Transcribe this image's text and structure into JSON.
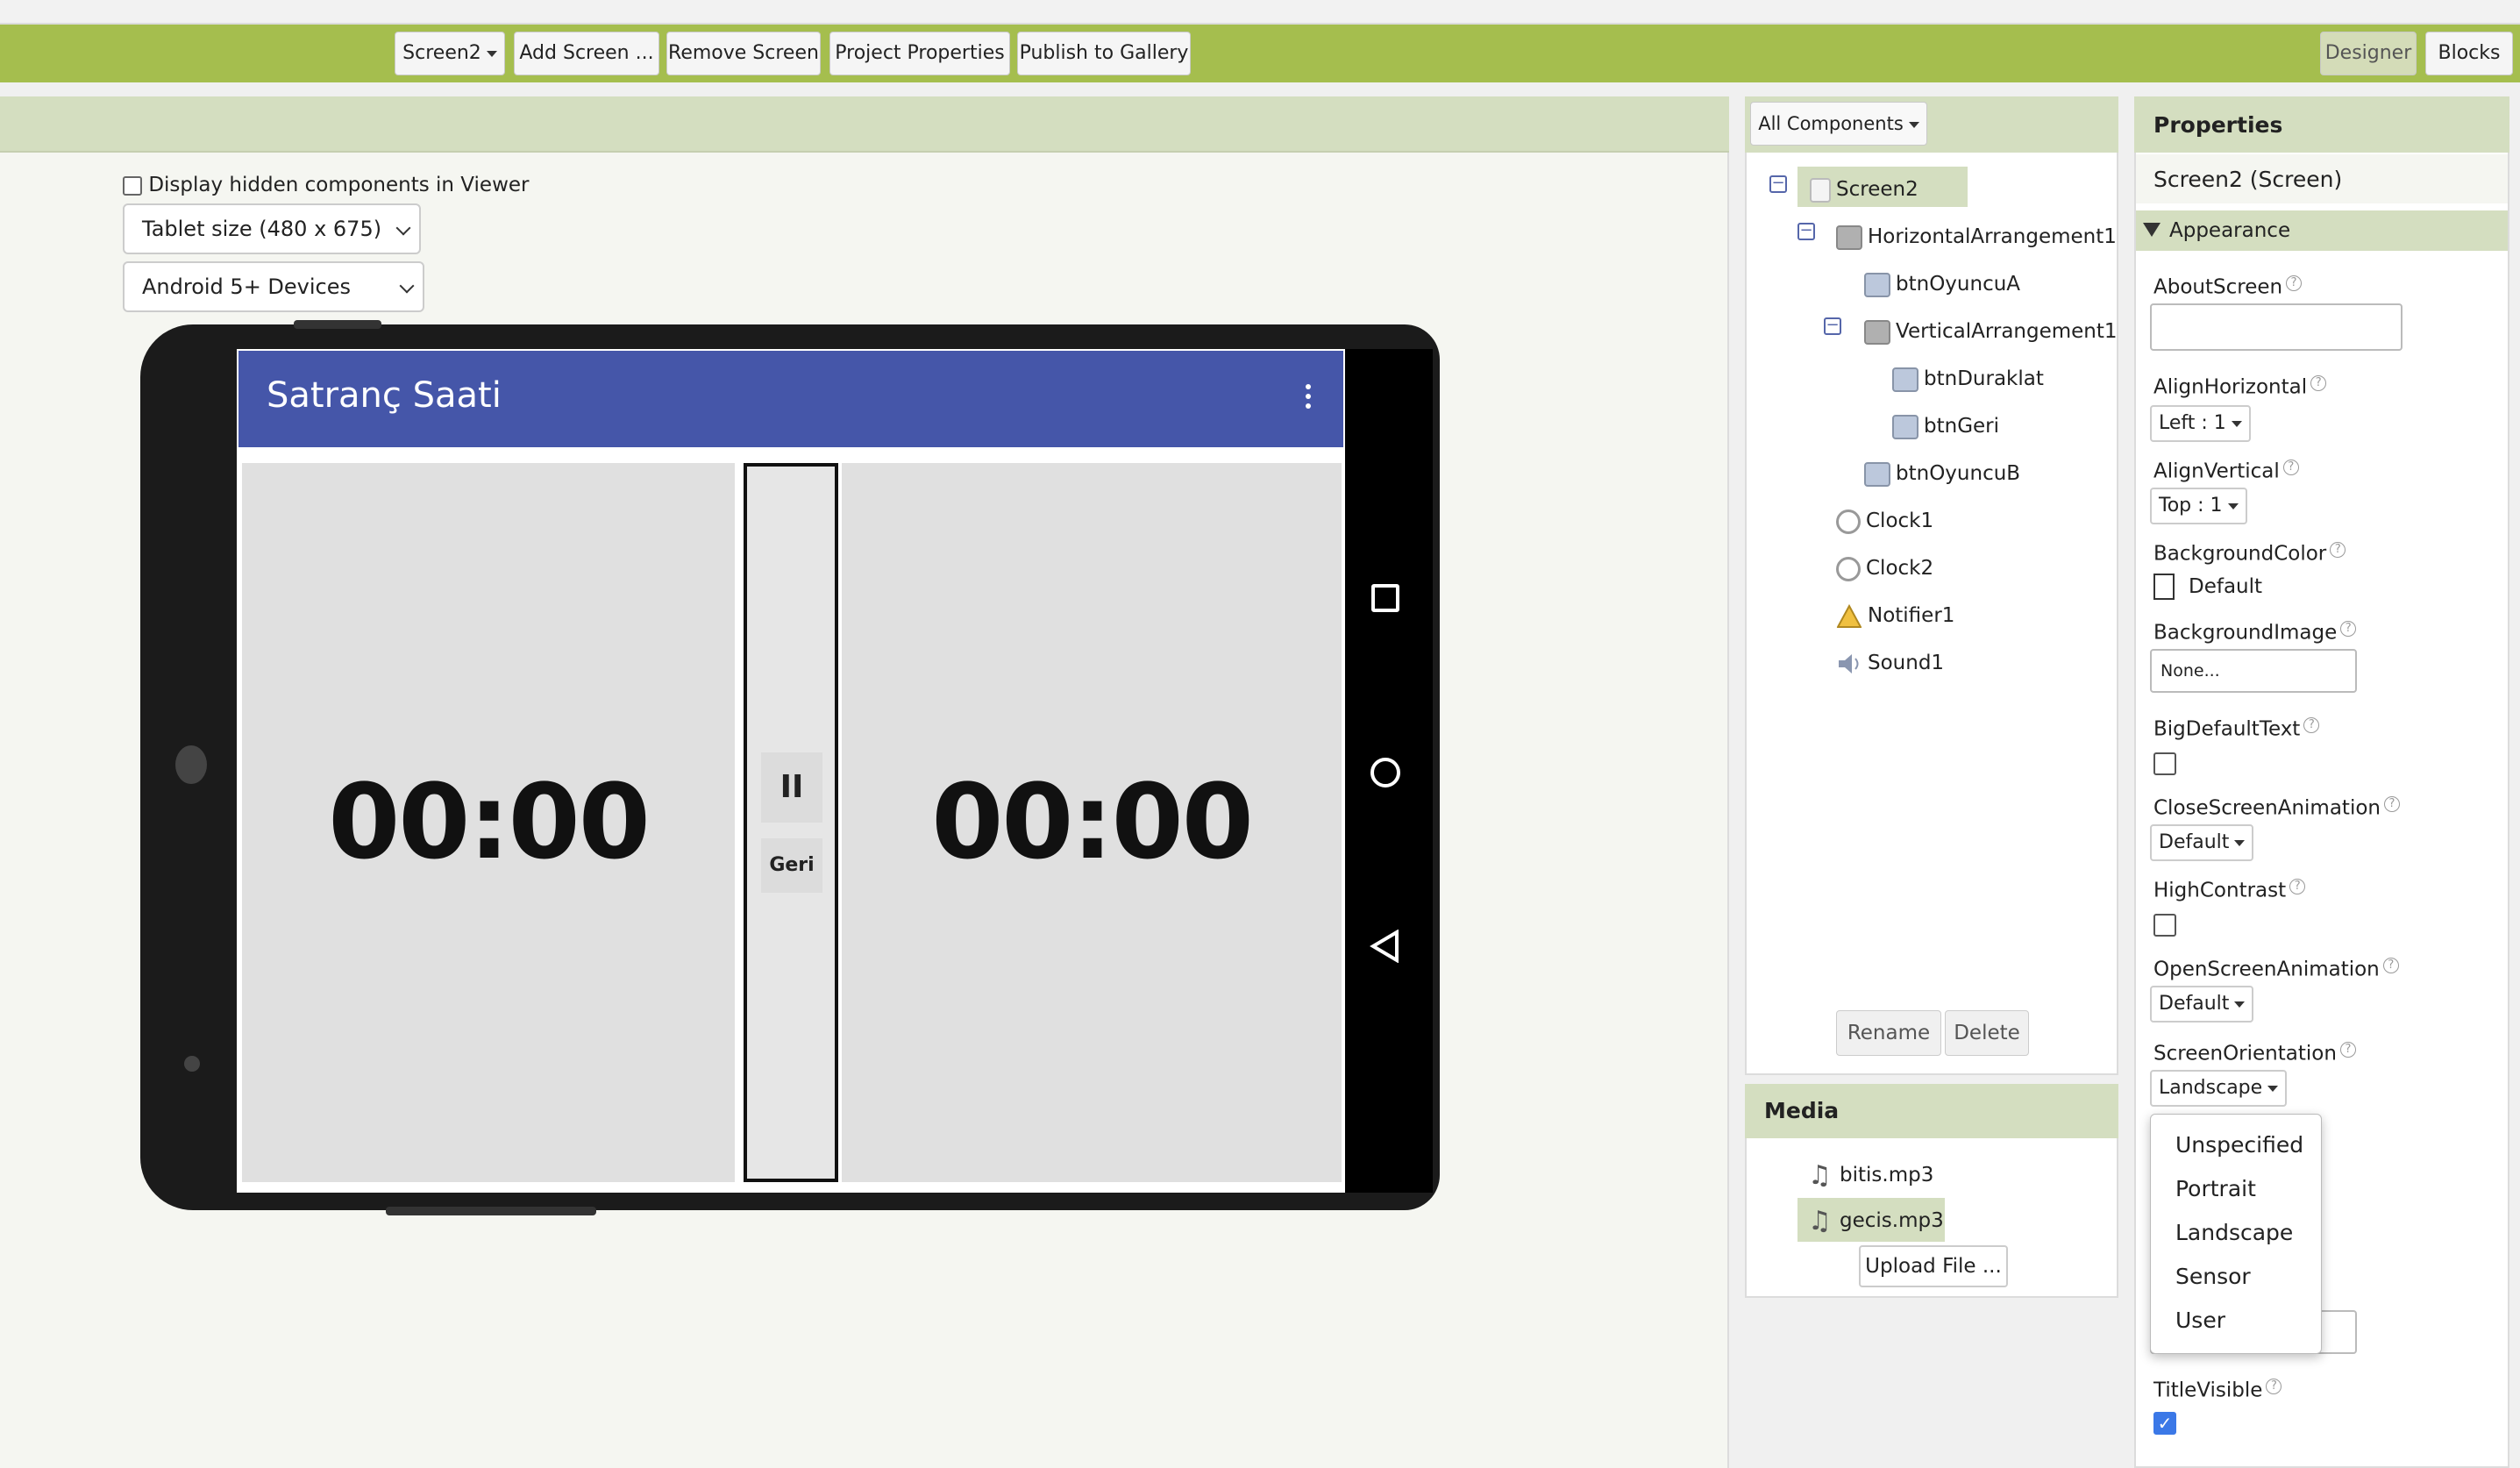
{
  "toolbar": {
    "screen_select": "Screen2",
    "add_screen": "Add Screen ...",
    "remove_screen": "Remove Screen",
    "project_properties": "Project Properties",
    "publish": "Publish to Gallery",
    "designer": "Designer",
    "blocks": "Blocks"
  },
  "viewer": {
    "hidden_label": "Display hidden components in Viewer",
    "size_select": "Tablet size (480 x 675)",
    "device_select": "Android 5+ Devices"
  },
  "app": {
    "title": "Satranç Saati",
    "timer_a": "00:00",
    "timer_b": "00:00",
    "pause_icon": "II",
    "back_label": "Geri"
  },
  "components": {
    "filter": "All Components",
    "items": [
      {
        "label": "Screen2",
        "icon": "screen-icon"
      },
      {
        "label": "HorizontalArrangement1",
        "icon": "horizontal-arrangement-icon"
      },
      {
        "label": "btnOyuncuA",
        "icon": "button-icon"
      },
      {
        "label": "VerticalArrangement1",
        "icon": "vertical-arrangement-icon"
      },
      {
        "label": "btnDuraklat",
        "icon": "button-icon"
      },
      {
        "label": "btnGeri",
        "icon": "button-icon"
      },
      {
        "label": "btnOyuncuB",
        "icon": "button-icon"
      },
      {
        "label": "Clock1",
        "icon": "clock-icon"
      },
      {
        "label": "Clock2",
        "icon": "clock-icon"
      },
      {
        "label": "Notifier1",
        "icon": "warning-icon"
      },
      {
        "label": "Sound1",
        "icon": "speaker-icon"
      }
    ],
    "rename": "Rename",
    "delete": "Delete"
  },
  "media": {
    "title": "Media",
    "files": [
      "bitis.mp3",
      "gecis.mp3"
    ],
    "upload": "Upload File ..."
  },
  "properties": {
    "title": "Properties",
    "component": "Screen2 (Screen)",
    "section": "Appearance",
    "about_screen": "AboutScreen",
    "align_horizontal": "AlignHorizontal",
    "align_horizontal_value": "Left : 1",
    "align_vertical": "AlignVertical",
    "align_vertical_value": "Top : 1",
    "background_color": "BackgroundColor",
    "background_color_value": "Default",
    "background_image": "BackgroundImage",
    "background_image_value": "None...",
    "big_default_text": "BigDefaultText",
    "close_screen_animation": "CloseScreenAnimation",
    "close_screen_animation_value": "Default",
    "high_contrast": "HighContrast",
    "open_screen_animation": "OpenScreenAnimation",
    "open_screen_animation_value": "Default",
    "screen_orientation": "ScreenOrientation",
    "screen_orientation_value": "Landscape",
    "title_visible": "TitleVisible",
    "help_mark": "?"
  },
  "orientation_menu": [
    "Unspecified",
    "Portrait",
    "Landscape",
    "Sensor",
    "User"
  ],
  "colors": {
    "toolbar": "#a5be4e",
    "panel_header": "#d4dec0",
    "app_bar": "#4556a9"
  }
}
